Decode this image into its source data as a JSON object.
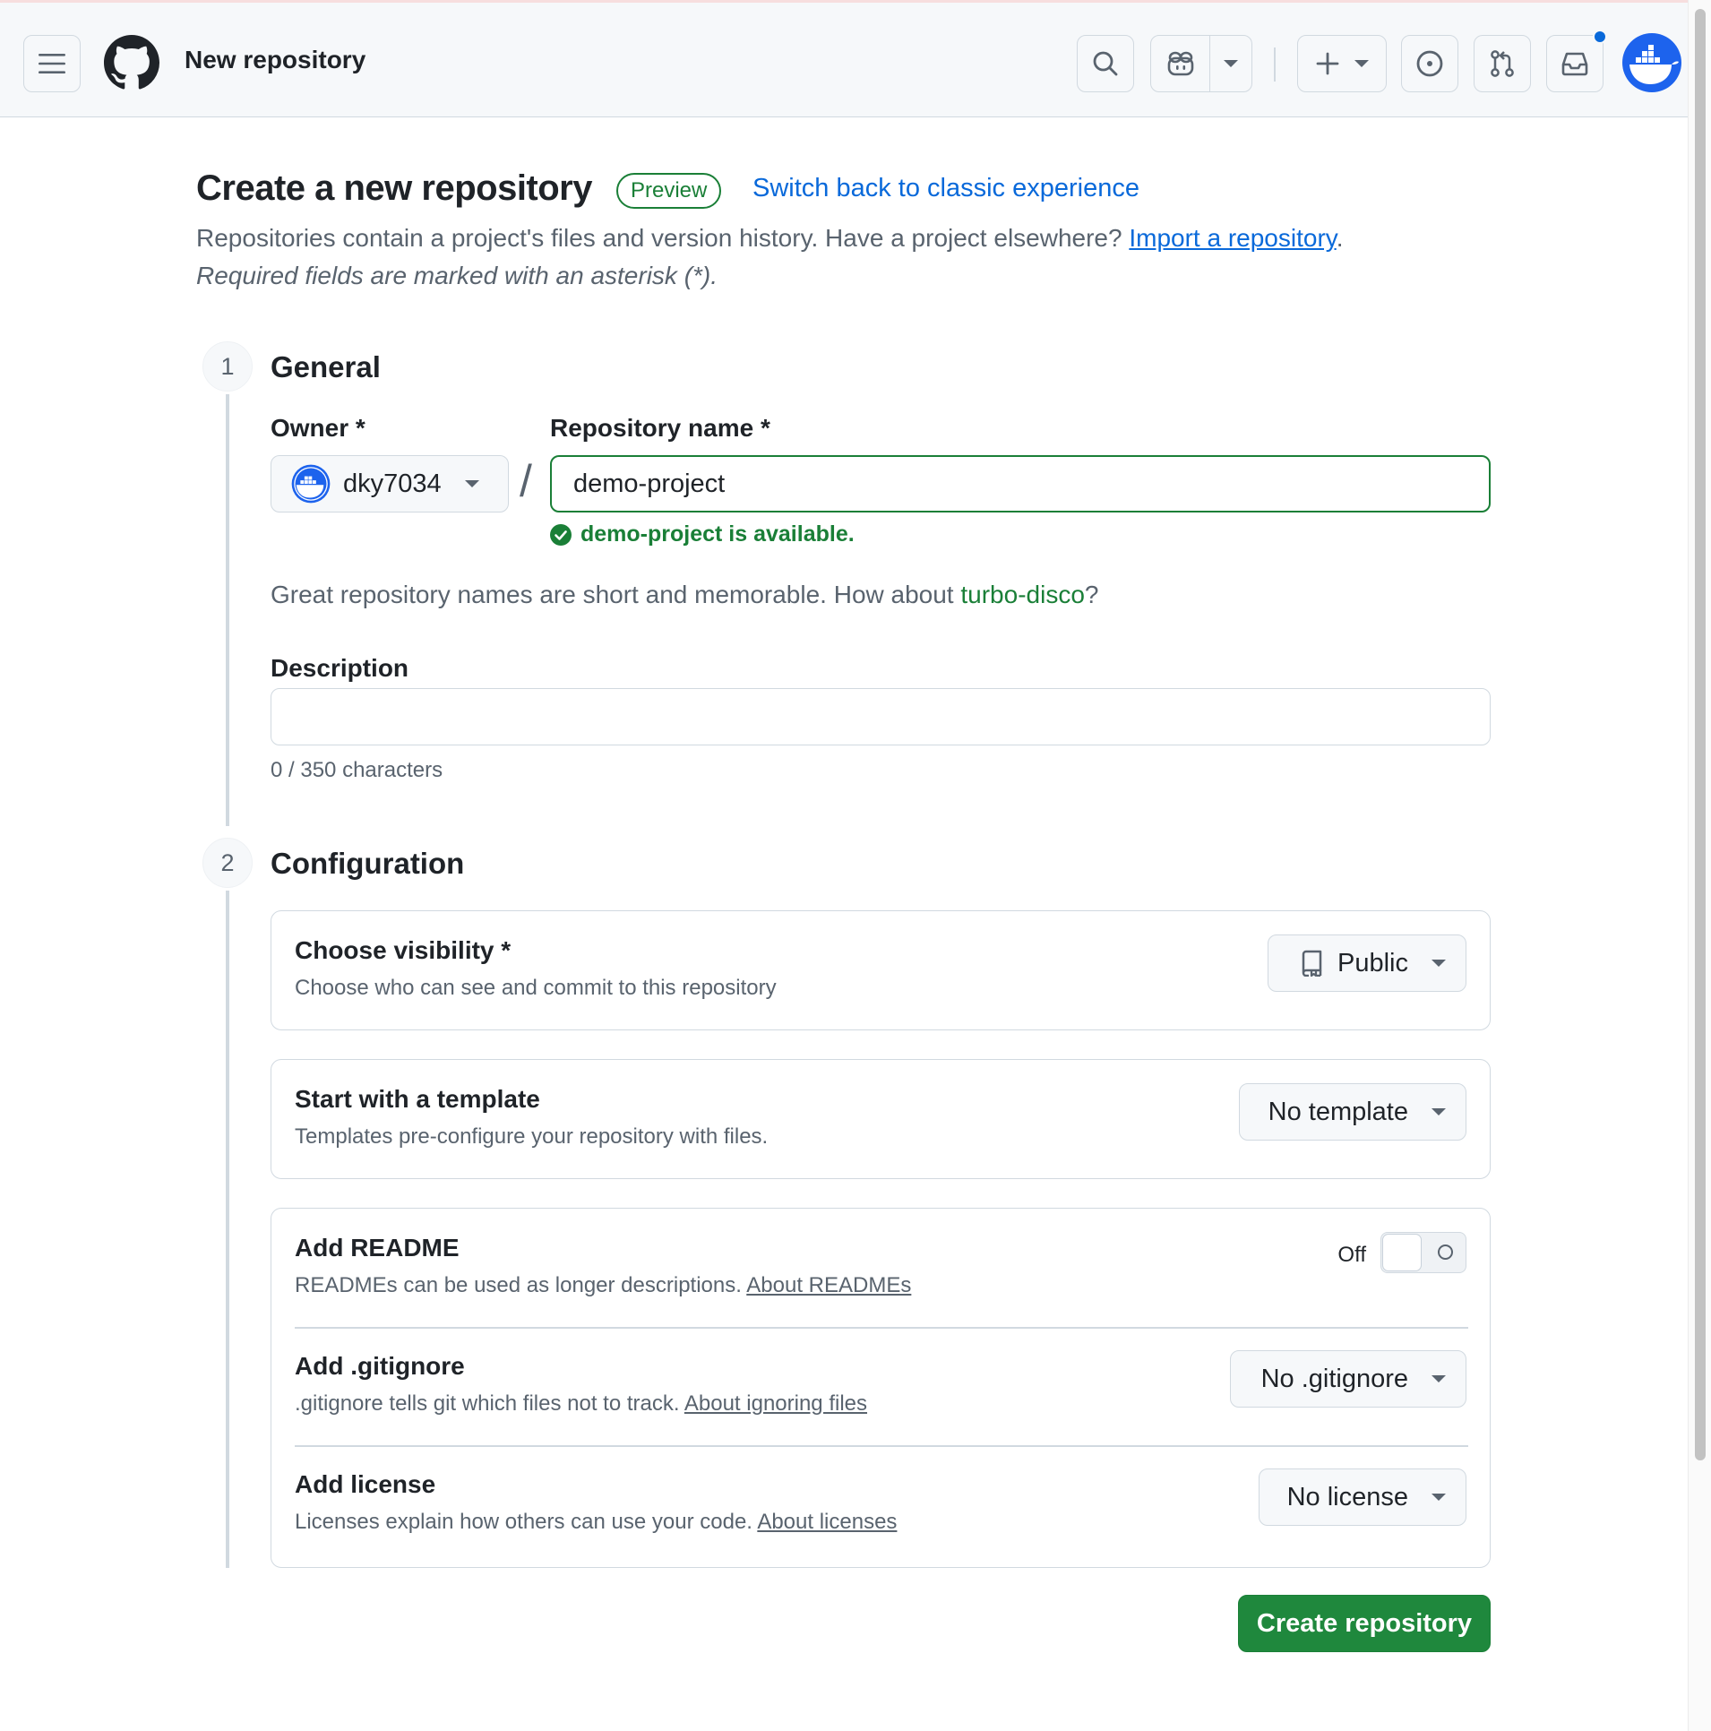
{
  "header": {
    "title": "New repository",
    "icons": [
      "menu-icon",
      "github-logo-icon",
      "search-icon",
      "copilot-icon",
      "plus-icon",
      "issues-icon",
      "pull-request-icon",
      "inbox-icon",
      "avatar"
    ],
    "notification_dot_color": "#0969da"
  },
  "page": {
    "heading": "Create a new repository",
    "badge": "Preview",
    "switch_link": "Switch back to classic experience",
    "subtitle_text": "Repositories contain a project's files and version history. Have a project elsewhere? ",
    "import_link": "Import a repository",
    "subtitle_end": ".",
    "required_note": "Required fields are marked with an asterisk (*)."
  },
  "general": {
    "step": "1",
    "title": "General",
    "owner_label": "Owner *",
    "owner_value": "dky7034",
    "slash": "/",
    "repo_label": "Repository name *",
    "repo_value": "demo-project",
    "availability": "demo-project is available.",
    "suggestion_prefix": "Great repository names are short and memorable. How about ",
    "suggestion_name": "turbo-disco",
    "suggestion_suffix": "?",
    "description_label": "Description",
    "description_value": "",
    "char_count": "0 / 350 characters"
  },
  "configuration": {
    "step": "2",
    "title": "Configuration",
    "visibility": {
      "title": "Choose visibility *",
      "desc": "Choose who can see and commit to this repository",
      "value": "Public"
    },
    "template": {
      "title": "Start with a template",
      "desc": "Templates pre-configure your repository with files.",
      "value": "No template"
    },
    "readme": {
      "title": "Add README",
      "desc": "READMEs can be used as longer descriptions. ",
      "link": "About READMEs",
      "toggle_label": "Off",
      "enabled": false
    },
    "gitignore": {
      "title": "Add .gitignore",
      "desc": ".gitignore tells git which files not to track. ",
      "link": "About ignoring files",
      "value": "No .gitignore"
    },
    "license": {
      "title": "Add license",
      "desc": "Licenses explain how others can use your code. ",
      "link": "About licenses",
      "value": "No license"
    }
  },
  "actions": {
    "create_label": "Create repository"
  },
  "colors": {
    "accent_green": "#1f883d",
    "link_blue": "#0969da",
    "avatar_blue": "#1d63ed"
  }
}
